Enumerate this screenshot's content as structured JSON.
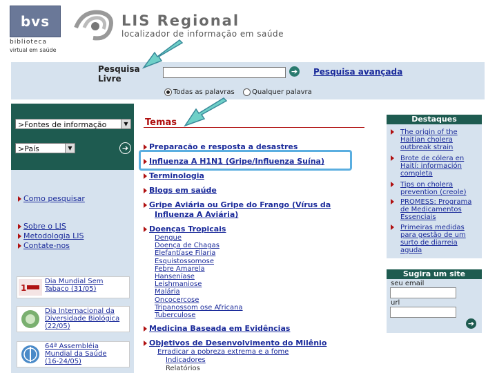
{
  "logo": {
    "box": "bvs",
    "line1": "biblioteca",
    "line2": "virtual em saúde"
  },
  "header": {
    "title": "LIS Regional",
    "subtitle": "localizador de informação em saúde"
  },
  "search": {
    "label_line1": "Pesquisa",
    "label_line2": "Livre",
    "value": "",
    "advanced_link": "Pesquisa avançada",
    "radio_all": "Todas as palavras",
    "radio_any": "Qualquer palavra",
    "selected_radio": "Todas as palavras"
  },
  "left": {
    "select_sources": ">Fontes de informação",
    "select_country": ">País",
    "how_to": "Como pesquisar",
    "links": [
      "Sobre o LIS",
      "Metodologia LIS",
      "Contate-nos"
    ],
    "promos": [
      {
        "line1": "Dia Mundial Sem",
        "line2": "Tabaco (31/05)",
        "line3": ""
      },
      {
        "line1": "Dia Internacional da",
        "line2": "Diversidade Biológica",
        "line3": "(22/05)"
      },
      {
        "line1": "64ª Assembléia",
        "line2": "Mundial da Saúde",
        "line3": "(16-24/05)"
      }
    ]
  },
  "main": {
    "heading": "Temas",
    "topics": {
      "t1": "Preparação e resposta a desastres",
      "t2": "Influenza A H1N1 (Gripe/Influenza Suína)",
      "t3": "Terminologia",
      "t4": "Blogs em saúde",
      "t5a": "Gripe Aviária ou Gripe do Frango (Vírus da",
      "t5b": "Influenza A Aviária)",
      "t6": "Doenças Tropicais",
      "t7": "Medicina Baseada em Evidências",
      "t8": "Objetivos de Desenvolvimento do Milênio"
    },
    "tropical": [
      "Dengue",
      "Doença de Chagas",
      "Elefantíase Filaria",
      "Esquistossomose",
      "Febre Amarela",
      "Hanseníase",
      "Leishmaniose",
      "Malária",
      "Oncocercose",
      "Tripanossom ose Africana",
      "Tuberculose"
    ],
    "odm": [
      "Erradicar a pobreza extrema e a fome",
      "Indicadores",
      "Relatórios"
    ]
  },
  "highlights": {
    "title": "Destaques",
    "items": [
      [
        "The origin of the",
        "Haitian cholera",
        "outbreak strain"
      ],
      [
        "Brote de cólera en",
        "Haití: información",
        "completa"
      ],
      [
        "Tips on cholera",
        "prevention (creole)"
      ],
      [
        "PROMESS: Programa",
        "de Medicamentos",
        "Essenciais"
      ],
      [
        "Primeiras medidas",
        "para gestão de um",
        "surto de diarreia",
        "aguda"
      ]
    ]
  },
  "suggest": {
    "title": "Sugira um site",
    "email_label": "seu email",
    "url_label": "url"
  },
  "colors": {
    "dark_green": "#1e5b50",
    "panel_blue": "#d6e2ee",
    "red": "#b01010",
    "link": "#1a2a9a",
    "highlight": "#5aaee0",
    "arrow": "#6fd0c8"
  }
}
